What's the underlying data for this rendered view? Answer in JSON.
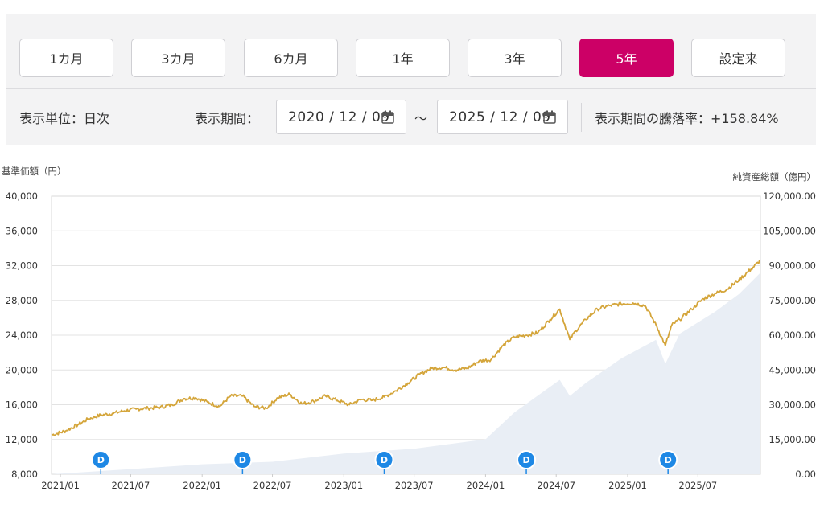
{
  "controls": {
    "periods": [
      {
        "label": "1カ月",
        "active": false
      },
      {
        "label": "3カ月",
        "active": false
      },
      {
        "label": "6カ月",
        "active": false
      },
      {
        "label": "1年",
        "active": false
      },
      {
        "label": "3年",
        "active": false
      },
      {
        "label": "5年",
        "active": true
      },
      {
        "label": "設定来",
        "active": false
      }
    ],
    "unit_label": "表示単位：日次",
    "period_label": "表示期間：",
    "start_date": "2020 / 12 / 09",
    "range_sep": "～",
    "end_date": "2025 / 12 / 09",
    "change_label": "表示期間の騰落率：+158.84%"
  },
  "colors": {
    "accent": "#cc0066",
    "nav_line": "#d4a53a",
    "aum_area": "#e9eef5",
    "dividend_marker": "#1e88e5"
  },
  "chart_data": {
    "type": "line",
    "ylabel_left": "基準価額（円）",
    "ylabel_right": "純資産総額（億円）",
    "x_ticks": [
      "2021/01",
      "2021/07",
      "2022/01",
      "2022/07",
      "2023/01",
      "2023/07",
      "2024/01",
      "2024/07",
      "2025/01",
      "2025/07"
    ],
    "y_left_ticks": [
      "8,000",
      "12,000",
      "16,000",
      "20,000",
      "24,000",
      "28,000",
      "32,000",
      "36,000",
      "40,000"
    ],
    "y_right_ticks": [
      "0.00",
      "15,000.00",
      "30,000.00",
      "45,000.00",
      "60,000.00",
      "75,000.00",
      "90,000.00",
      "105,000.00",
      "120,000.00"
    ],
    "ylim_left": [
      8000,
      40000
    ],
    "ylim_right": [
      0,
      120000
    ],
    "grid": true,
    "series": [
      {
        "axis": "left",
        "x": [
          "2020-12-09",
          "2021-01-15",
          "2021-02-15",
          "2021-03-15",
          "2021-04-15",
          "2021-05-15",
          "2021-06-15",
          "2021-07-15",
          "2021-08-15",
          "2021-09-15",
          "2021-10-15",
          "2021-11-15",
          "2021-12-15",
          "2022-01-15",
          "2022-02-15",
          "2022-03-15",
          "2022-04-15",
          "2022-05-15",
          "2022-06-15",
          "2022-07-15",
          "2022-08-15",
          "2022-09-15",
          "2022-10-15",
          "2022-11-15",
          "2022-12-15",
          "2023-01-15",
          "2023-02-15",
          "2023-03-15",
          "2023-04-15",
          "2023-05-15",
          "2023-06-15",
          "2023-07-15",
          "2023-08-15",
          "2023-09-15",
          "2023-10-15",
          "2023-11-15",
          "2023-12-15",
          "2024-01-15",
          "2024-02-15",
          "2024-03-15",
          "2024-04-15",
          "2024-05-15",
          "2024-06-15",
          "2024-07-10",
          "2024-08-05",
          "2024-08-20",
          "2024-09-15",
          "2024-10-15",
          "2024-11-15",
          "2024-12-15",
          "2025-01-15",
          "2025-02-15",
          "2025-03-15",
          "2025-04-08",
          "2025-04-25",
          "2025-05-15",
          "2025-06-15",
          "2025-07-15",
          "2025-08-15",
          "2025-09-15",
          "2025-10-15",
          "2025-11-15",
          "2025-12-09"
        ],
        "values": [
          12500,
          13000,
          13700,
          14400,
          14800,
          15000,
          15300,
          15500,
          15600,
          15700,
          16000,
          16700,
          16800,
          16300,
          15800,
          17000,
          17000,
          15800,
          15600,
          16800,
          17200,
          16100,
          16400,
          17000,
          16500,
          16000,
          16600,
          16500,
          16900,
          17600,
          18500,
          19500,
          20200,
          20300,
          20000,
          20200,
          21000,
          21200,
          22800,
          23800,
          24000,
          24300,
          25800,
          27000,
          23500,
          24500,
          25800,
          27000,
          27400,
          27600,
          27700,
          27400,
          25200,
          22800,
          25200,
          25800,
          27000,
          28200,
          28800,
          29300,
          30400,
          31600,
          32600
        ]
      },
      {
        "axis": "right",
        "x": [
          "2020-12-09",
          "2021-07-01",
          "2022-01-01",
          "2022-07-01",
          "2023-01-01",
          "2023-07-01",
          "2024-01-01",
          "2024-03-15",
          "2024-07-10",
          "2024-08-05",
          "2024-09-15",
          "2024-12-15",
          "2025-03-15",
          "2025-04-08",
          "2025-05-15",
          "2025-08-15",
          "2025-10-15",
          "2025-12-09"
        ],
        "values": [
          0,
          2000,
          4500,
          6000,
          8500,
          11000,
          15500,
          26000,
          40500,
          34000,
          40000,
          49500,
          58000,
          48000,
          60000,
          70000,
          78000,
          87000
        ]
      }
    ],
    "dividend_markers": [
      {
        "label": "D",
        "date": "2021-04-15"
      },
      {
        "label": "D",
        "date": "2022-04-15"
      },
      {
        "label": "D",
        "date": "2023-04-15"
      },
      {
        "label": "D",
        "date": "2024-04-15"
      },
      {
        "label": "D",
        "date": "2025-04-15"
      }
    ]
  }
}
